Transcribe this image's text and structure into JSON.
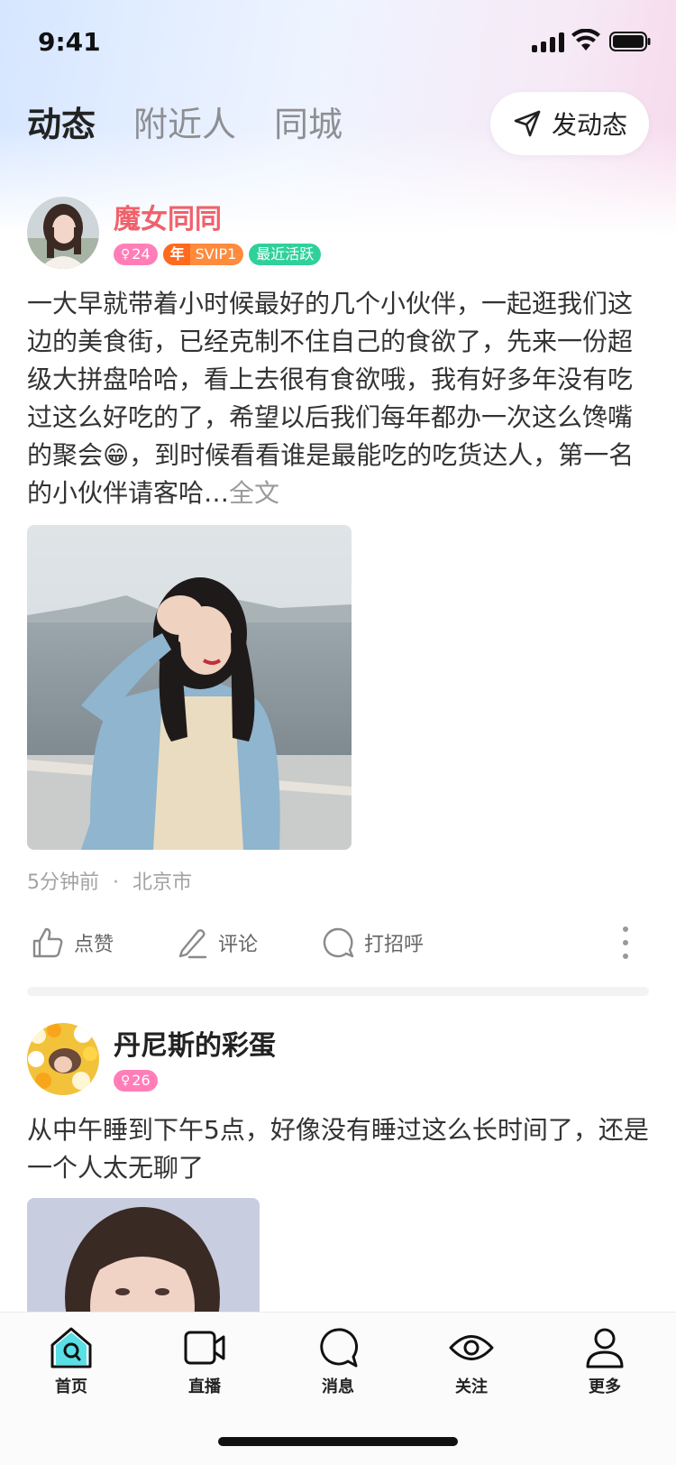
{
  "status_bar": {
    "time": "9:41"
  },
  "top_nav": {
    "tabs": [
      {
        "label": "动态",
        "active": true
      },
      {
        "label": "附近人",
        "active": false
      },
      {
        "label": "同城",
        "active": false
      }
    ],
    "post_button": {
      "label": "发动态",
      "icon": "send-icon"
    }
  },
  "feed": [
    {
      "username": "魔女同同",
      "badges": {
        "gender_age": "24",
        "year": "年",
        "svip": "SVIP1",
        "active": "最近活跃"
      },
      "text": "一大早就带着小时候最好的几个小伙伴，一起逛我们这边的美食街，已经克制不住自己的食欲了，先来一份超级大拼盘哈哈，看上去很有食欲哦，我有好多年没有吃过这么好吃的了，希望以后我们每年都办一次这么馋嘴的聚会😁，到时候看看谁是最能吃的吃货达人，第一名的小伙伴请客哈…",
      "more_label": "全文",
      "time": "5分钟前",
      "separator": "·",
      "location": "北京市",
      "actions": {
        "like": "点赞",
        "comment": "评论",
        "greet": "打招呼"
      }
    },
    {
      "username": "丹尼斯的彩蛋",
      "badges": {
        "gender_age": "26"
      },
      "text": "从中午睡到下午5点，好像没有睡过这么长时间了，还是一个人太无聊了"
    }
  ],
  "tabbar": {
    "items": [
      {
        "label": "首页",
        "icon": "home-icon",
        "active": true
      },
      {
        "label": "直播",
        "icon": "video-icon",
        "active": false
      },
      {
        "label": "消息",
        "icon": "message-icon",
        "active": false
      },
      {
        "label": "关注",
        "icon": "eye-icon",
        "active": false
      },
      {
        "label": "更多",
        "icon": "user-icon",
        "active": false
      }
    ]
  },
  "colors": {
    "accent_vip_name": "#f0616b",
    "badge_gender": "#ff7eb8",
    "badge_svip": "#ff8b3d",
    "badge_active": "#2fd19a",
    "home_tab_accent": "#58e0e6"
  }
}
